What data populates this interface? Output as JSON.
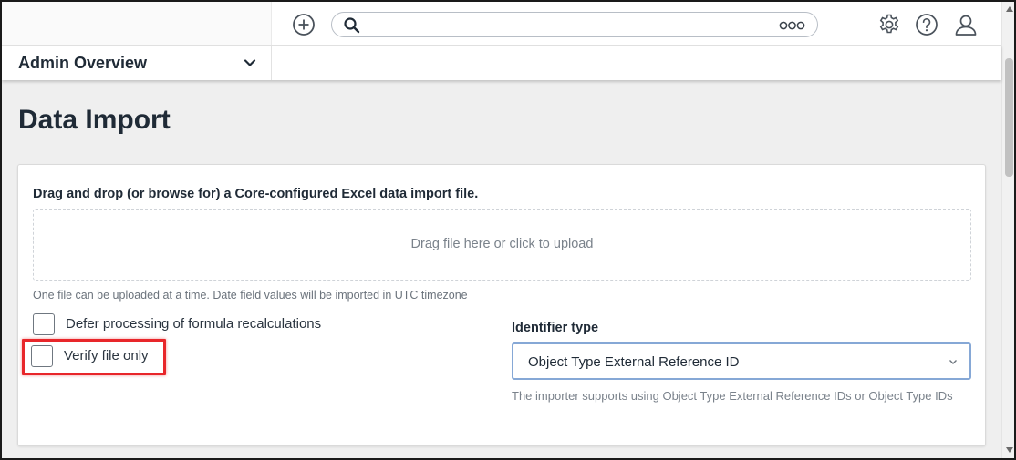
{
  "topbar": {
    "add_icon": "plus-circle-icon",
    "search": {
      "placeholder": "",
      "value": "",
      "options_icon": "ellipsis-circles-icon"
    },
    "settings_icon": "gear-icon",
    "help_icon": "question-circle-icon",
    "user_icon": "user-icon"
  },
  "subheader": {
    "dashboard_label": "Admin Overview",
    "chevron_icon": "chevron-down-icon"
  },
  "page": {
    "title": "Data Import"
  },
  "import_panel": {
    "instruction": "Drag and drop (or browse for) a Core-configured Excel data import file.",
    "dropzone_text": "Drag file here or click to upload",
    "upload_help": "One file can be uploaded at a time. Date field values will be imported in UTC timezone",
    "options": [
      {
        "label": "Defer processing of formula recalculations",
        "checked": false
      },
      {
        "label": "Verify file only",
        "checked": false
      }
    ],
    "identifier": {
      "label": "Identifier type",
      "selected": "Object Type External Reference ID",
      "help": "The importer supports using Object Type External Reference IDs or Object Type IDs"
    }
  },
  "colors": {
    "highlight": "#e8262a",
    "select_focus_border": "#86a8d6",
    "title_text": "#1f2a36"
  }
}
